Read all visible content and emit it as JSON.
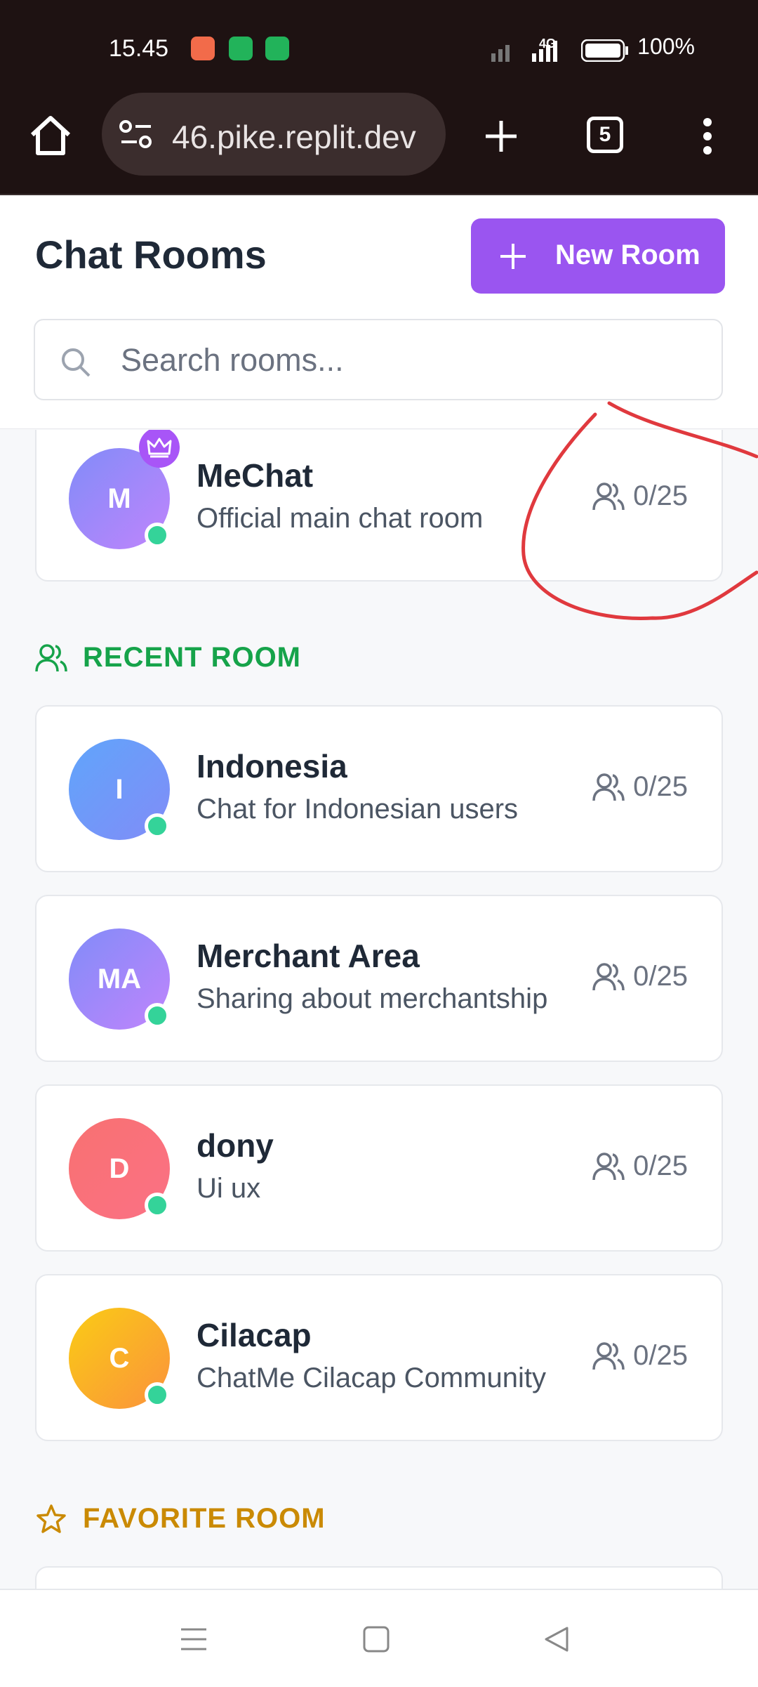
{
  "status_bar": {
    "time": "15.45",
    "signal": "4G",
    "battery": "100%"
  },
  "browser": {
    "url": "46.pike.replit.dev",
    "tab_count": "5"
  },
  "header": {
    "title": "Chat Rooms",
    "new_room_label": "New Room"
  },
  "search": {
    "placeholder": "Search rooms..."
  },
  "featured_room": {
    "name": "MeChat",
    "initials": "M",
    "description": "Official main chat room",
    "capacity": "0/25"
  },
  "sections": {
    "recent": "RECENT ROOM",
    "favorite": "FAVORITE ROOM"
  },
  "recent_rooms": [
    {
      "name": "Indonesia",
      "initials": "I",
      "description": "Chat for Indonesian users",
      "capacity": "0/25"
    },
    {
      "name": "Merchant Area",
      "initials": "MA",
      "description": "Sharing about merchantship",
      "capacity": "0/25"
    },
    {
      "name": "dony",
      "initials": "D",
      "description": "Ui ux",
      "capacity": "0/25"
    },
    {
      "name": "Cilacap",
      "initials": "C",
      "description": "ChatMe Cilacap Community",
      "capacity": "0/25"
    }
  ],
  "colors": {
    "accent": "#9a55f0",
    "recent_section": "#16a34a",
    "favorite_section": "#ca8a04",
    "online": "#34d399",
    "annotation": "#e0393e"
  }
}
